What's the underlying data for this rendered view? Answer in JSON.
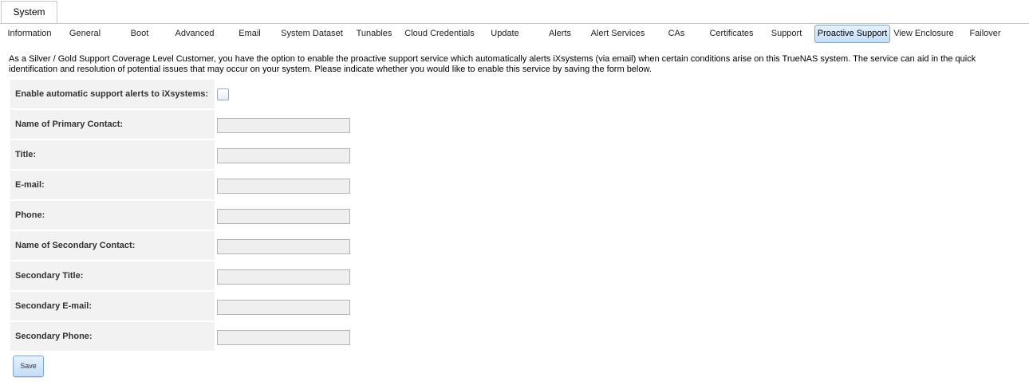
{
  "top_tabs": [
    {
      "label": "System"
    }
  ],
  "sub_tabs": [
    {
      "label": "Information"
    },
    {
      "label": "General"
    },
    {
      "label": "Boot"
    },
    {
      "label": "Advanced"
    },
    {
      "label": "Email"
    },
    {
      "label": "System Dataset"
    },
    {
      "label": "Tunables"
    },
    {
      "label": "Cloud Credentials"
    },
    {
      "label": "Update"
    },
    {
      "label": "Alerts"
    },
    {
      "label": "Alert Services"
    },
    {
      "label": "CAs"
    },
    {
      "label": "Certificates"
    },
    {
      "label": "Support"
    },
    {
      "label": "Proactive Support"
    },
    {
      "label": "View Enclosure"
    },
    {
      "label": "Failover"
    }
  ],
  "active_sub_tab": "Proactive Support",
  "intro_text": "As a Silver / Gold Support Coverage Level Customer, you have the option to enable the proactive support service which automatically alerts iXsystems (via email) when certain conditions arise on this TrueNAS system. The service can aid in the quick identification and resolution of potential issues that may occur on your system. Please indicate whether you would like to enable this service by saving the form below.",
  "form": {
    "enable_label": "Enable automatic support alerts to iXsystems:",
    "enable_checked": false,
    "fields": [
      {
        "label": "Name of Primary Contact:",
        "value": ""
      },
      {
        "label": "Title:",
        "value": ""
      },
      {
        "label": "E-mail:",
        "value": ""
      },
      {
        "label": "Phone:",
        "value": ""
      },
      {
        "label": "Name of Secondary Contact:",
        "value": ""
      },
      {
        "label": "Secondary Title:",
        "value": ""
      },
      {
        "label": "Secondary E-mail:",
        "value": ""
      },
      {
        "label": "Secondary Phone:",
        "value": ""
      }
    ],
    "save_label": "Save"
  },
  "colors": {
    "active_tab_border": "#7ea7d4",
    "active_tab_bg": "#c4ddf7",
    "row_bg": "#f2f2f2",
    "field_bg": "#efefef"
  }
}
